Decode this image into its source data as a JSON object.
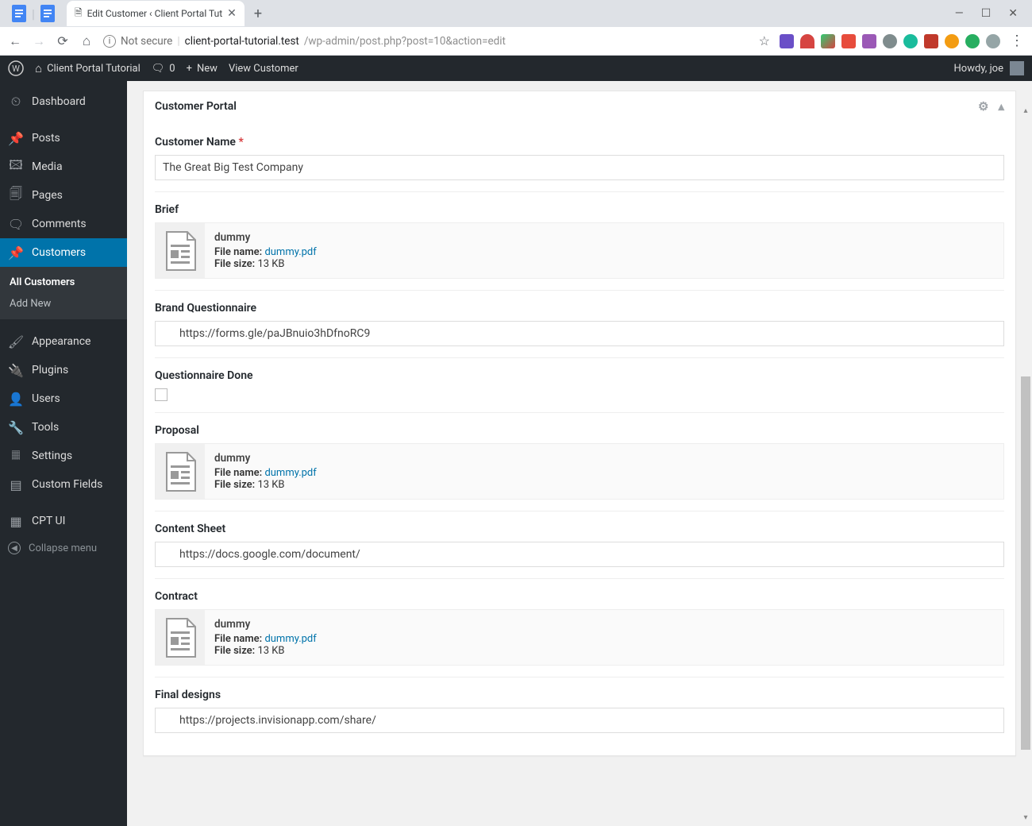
{
  "browser": {
    "tab_title": "Edit Customer ‹ Client Portal Tut",
    "address_prefix": "Not secure",
    "address_domain": "client-portal-tutorial.test",
    "address_path": "/wp-admin/post.php?post=10&action=edit"
  },
  "adminbar": {
    "site_title": "Client Portal Tutorial",
    "comments_count": "0",
    "new_label": "New",
    "view_label": "View Customer",
    "howdy": "Howdy, joe"
  },
  "sidebar": {
    "items": [
      {
        "label": "Dashboard"
      },
      {
        "label": "Posts"
      },
      {
        "label": "Media"
      },
      {
        "label": "Pages"
      },
      {
        "label": "Comments"
      },
      {
        "label": "Customers"
      },
      {
        "label": "Appearance"
      },
      {
        "label": "Plugins"
      },
      {
        "label": "Users"
      },
      {
        "label": "Tools"
      },
      {
        "label": "Settings"
      },
      {
        "label": "Custom Fields"
      },
      {
        "label": "CPT UI"
      }
    ],
    "submenu": {
      "all": "All Customers",
      "add": "Add New"
    },
    "collapse": "Collapse menu"
  },
  "postbox": {
    "title": "Customer Portal",
    "fields": {
      "customer_name": {
        "label": "Customer Name",
        "value": "The Great Big Test Company",
        "required": true
      },
      "brief": {
        "label": "Brief",
        "doc_title": "dummy",
        "filename_label": "File name:",
        "filename": "dummy.pdf",
        "filesize_label": "File size:",
        "filesize": "13 KB"
      },
      "brand_q": {
        "label": "Brand Questionnaire",
        "value": "https://forms.gle/paJBnuio3hDfnoRC9"
      },
      "q_done": {
        "label": "Questionnaire Done"
      },
      "proposal": {
        "label": "Proposal",
        "doc_title": "dummy",
        "filename_label": "File name:",
        "filename": "dummy.pdf",
        "filesize_label": "File size:",
        "filesize": "13 KB"
      },
      "content_sheet": {
        "label": "Content Sheet",
        "value": "https://docs.google.com/document/"
      },
      "contract": {
        "label": "Contract",
        "doc_title": "dummy",
        "filename_label": "File name:",
        "filename": "dummy.pdf",
        "filesize_label": "File size:",
        "filesize": "13 KB"
      },
      "final_designs": {
        "label": "Final designs",
        "value": "https://projects.invisionapp.com/share/"
      }
    }
  }
}
